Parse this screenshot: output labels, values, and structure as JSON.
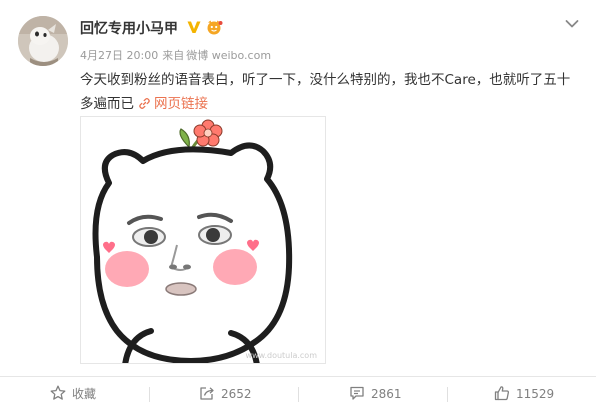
{
  "user": {
    "name": "回忆专用小马甲"
  },
  "meta": {
    "date": "4月27日 20:00",
    "source_prefix": "来自",
    "source": "微博 weibo.com"
  },
  "post": {
    "text": "今天收到粉丝的语音表白，听了一下，没什么特别的，我也不Care，也就听了五十多遍而已",
    "link_label": "网页链接"
  },
  "image": {
    "watermark": "www.doutula.com"
  },
  "actions": {
    "favorite": "收藏",
    "share": "2652",
    "comment": "2861",
    "like": "11529"
  },
  "colors": {
    "link": "#eb7350",
    "verified": "#f4b400",
    "muted": "#808080",
    "divider": "#e6e6e6"
  },
  "icons": {
    "verified": "verified-v-icon",
    "vip": "vip-crown-icon",
    "more": "chevron-down-icon",
    "link": "link-icon",
    "favorite": "star-icon",
    "share": "share-icon",
    "comment": "comment-icon",
    "like": "thumbs-up-icon"
  }
}
